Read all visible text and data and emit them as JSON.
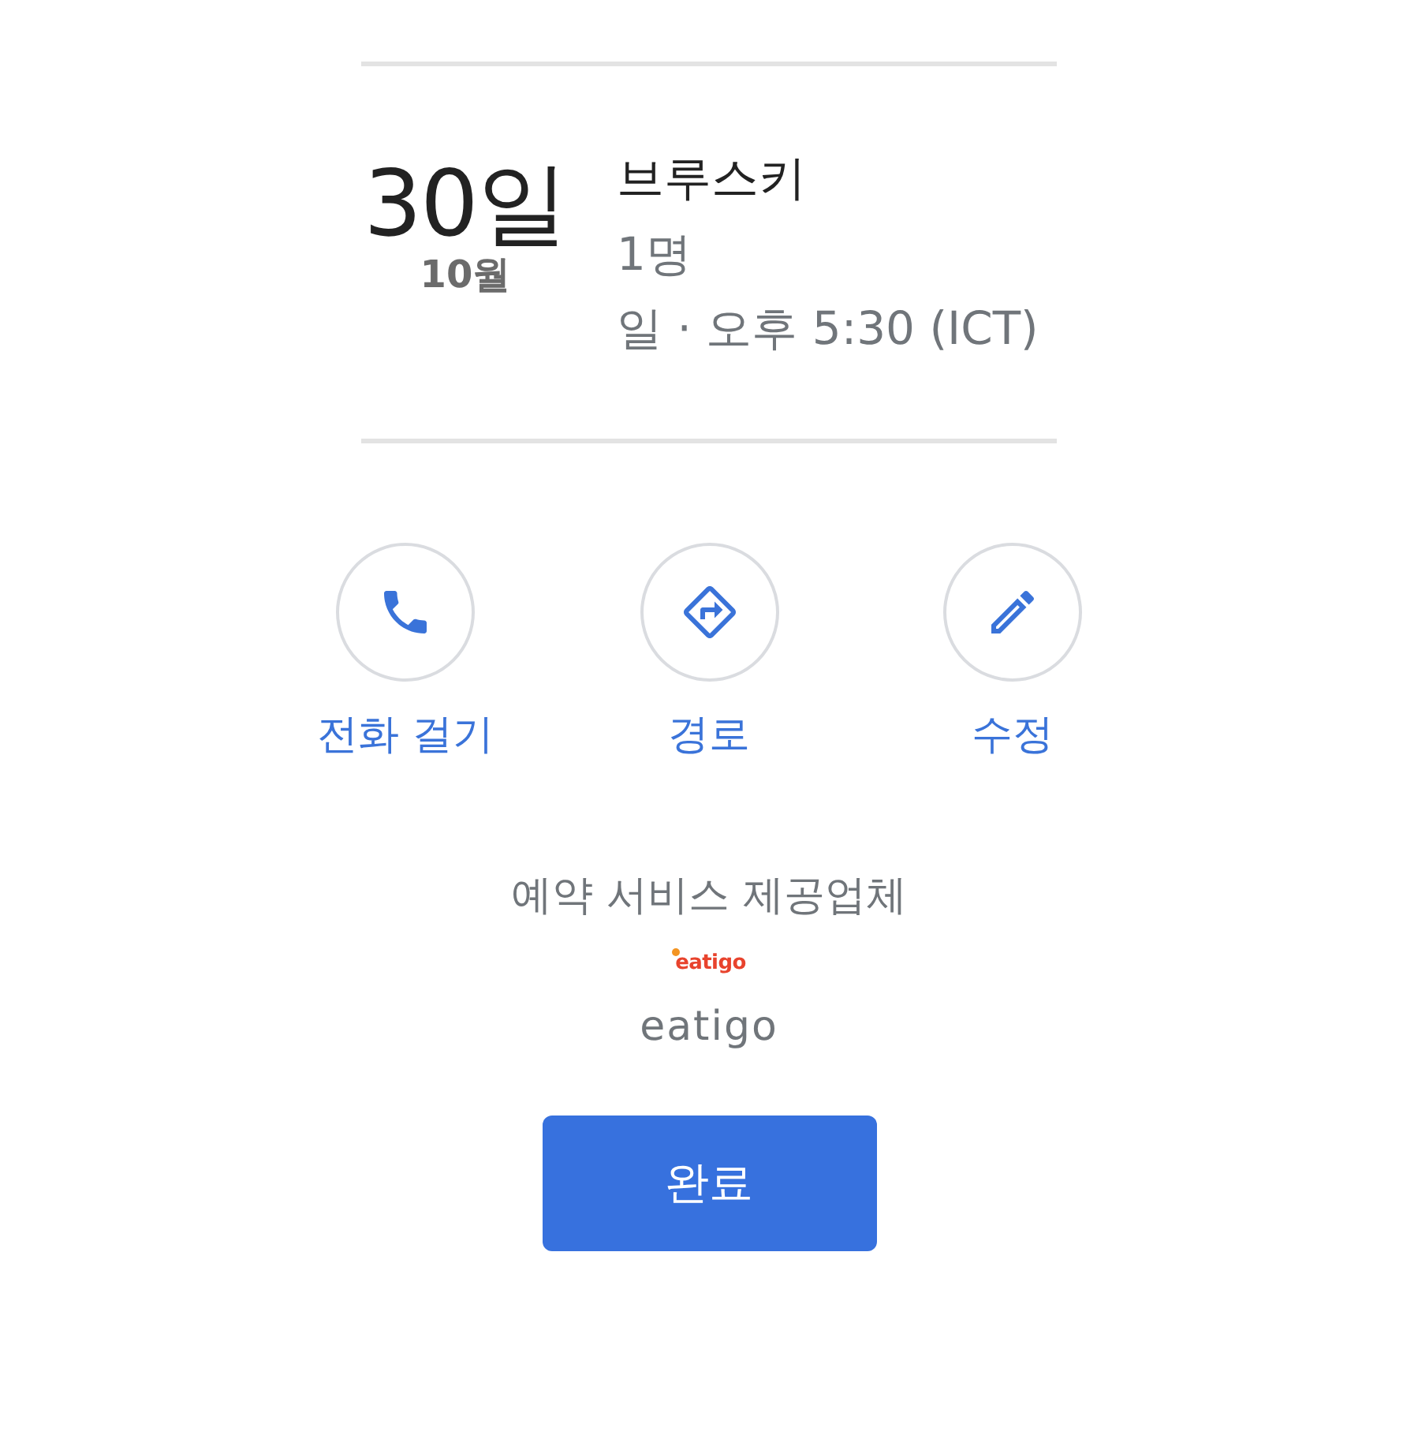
{
  "reservation": {
    "day": "30일",
    "month": "10월",
    "restaurant": "브루스키",
    "party_size": "1명",
    "time": "일 · 오후 5:30 (ICT)"
  },
  "actions": [
    {
      "kind": "call",
      "label": "전화 걸기"
    },
    {
      "kind": "directions",
      "label": "경로"
    },
    {
      "kind": "edit",
      "label": "수정"
    }
  ],
  "provider": {
    "heading": "예약 서비스 제공업체",
    "logo_text": "eatigo",
    "name": "eatigo"
  },
  "done_button": "완료"
}
